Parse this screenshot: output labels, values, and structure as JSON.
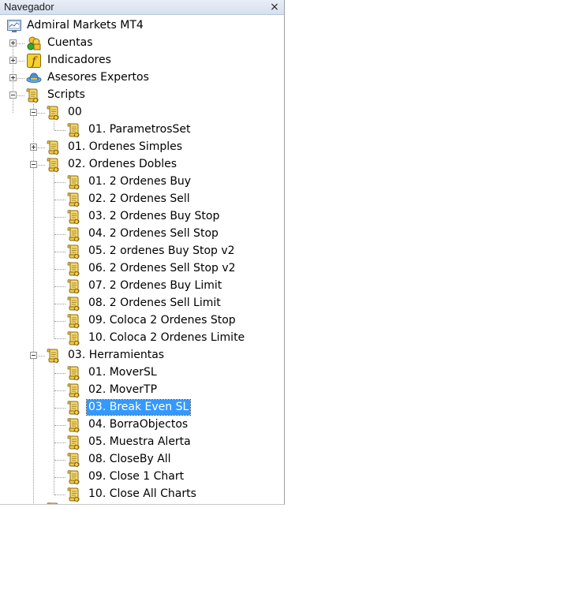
{
  "window": {
    "title": "Navegador",
    "close_glyph": "×"
  },
  "tree": {
    "root": "Admiral Markets MT4",
    "cuentas": "Cuentas",
    "indicadores": "Indicadores",
    "asesores": "Asesores Expertos",
    "scripts": "Scripts",
    "f00": "00",
    "f00_items": [
      "01. ParametrosSet"
    ],
    "f01": "01. Ordenes Simples",
    "f02": "02. Ordenes Dobles",
    "f02_items": [
      "01. 2 Ordenes Buy",
      "02. 2 Ordenes Sell",
      "03. 2 Ordenes Buy Stop",
      "04. 2 Ordenes Sell Stop",
      "05. 2 ordenes Buy Stop v2",
      "06. 2 Ordenes Sell Stop v2",
      "07. 2 Ordenes Buy Limit",
      "08. 2 Ordenes Sell Limit",
      "09. Coloca 2 Ordenes Stop",
      "10. Coloca 2 Ordenes Limite"
    ],
    "f03": "03. Herramientas",
    "f03_items": [
      "01. MoverSL",
      "02. MoverTP",
      "03. Break Even SL",
      "04. BorraObjectos",
      "05. Muestra Alerta",
      "08. CloseBy All",
      "09. Close 1 Chart",
      "10. Close All Charts"
    ],
    "selected_item": "03. Break Even SL"
  },
  "colors": {
    "selection": "#3399ff",
    "titlebar": "#dce5f2"
  },
  "icons": {
    "root": "terminal-icon",
    "cuentas": "accounts-icon",
    "indicadores": "indicator-icon",
    "asesores": "expert-advisor-icon",
    "script": "script-scroll-icon"
  }
}
